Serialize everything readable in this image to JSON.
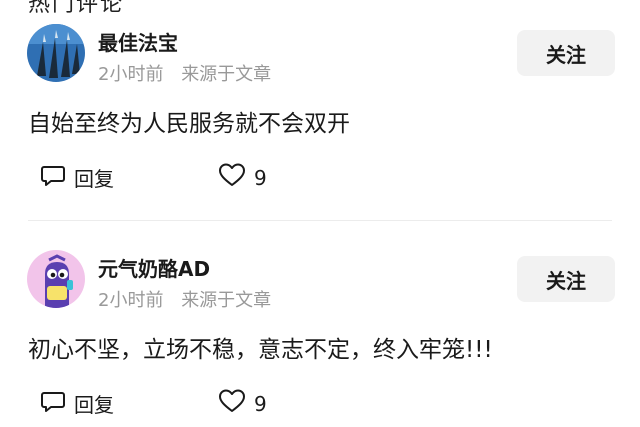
{
  "top_partial_text": "热门评论",
  "comments": [
    {
      "username": "最佳法宝",
      "time": "2小时前",
      "source": "来源于文章",
      "follow_label": "关注",
      "text": "自始至终为人民服务就不会双开",
      "reply_label": "回复",
      "like_count": "9"
    },
    {
      "username": "元气奶酪AD",
      "time": "2小时前",
      "source": "来源于文章",
      "follow_label": "关注",
      "text": "初心不坚，立场不稳，意志不定，终入牢笼!!!",
      "reply_label": "回复",
      "like_count": "9"
    }
  ]
}
